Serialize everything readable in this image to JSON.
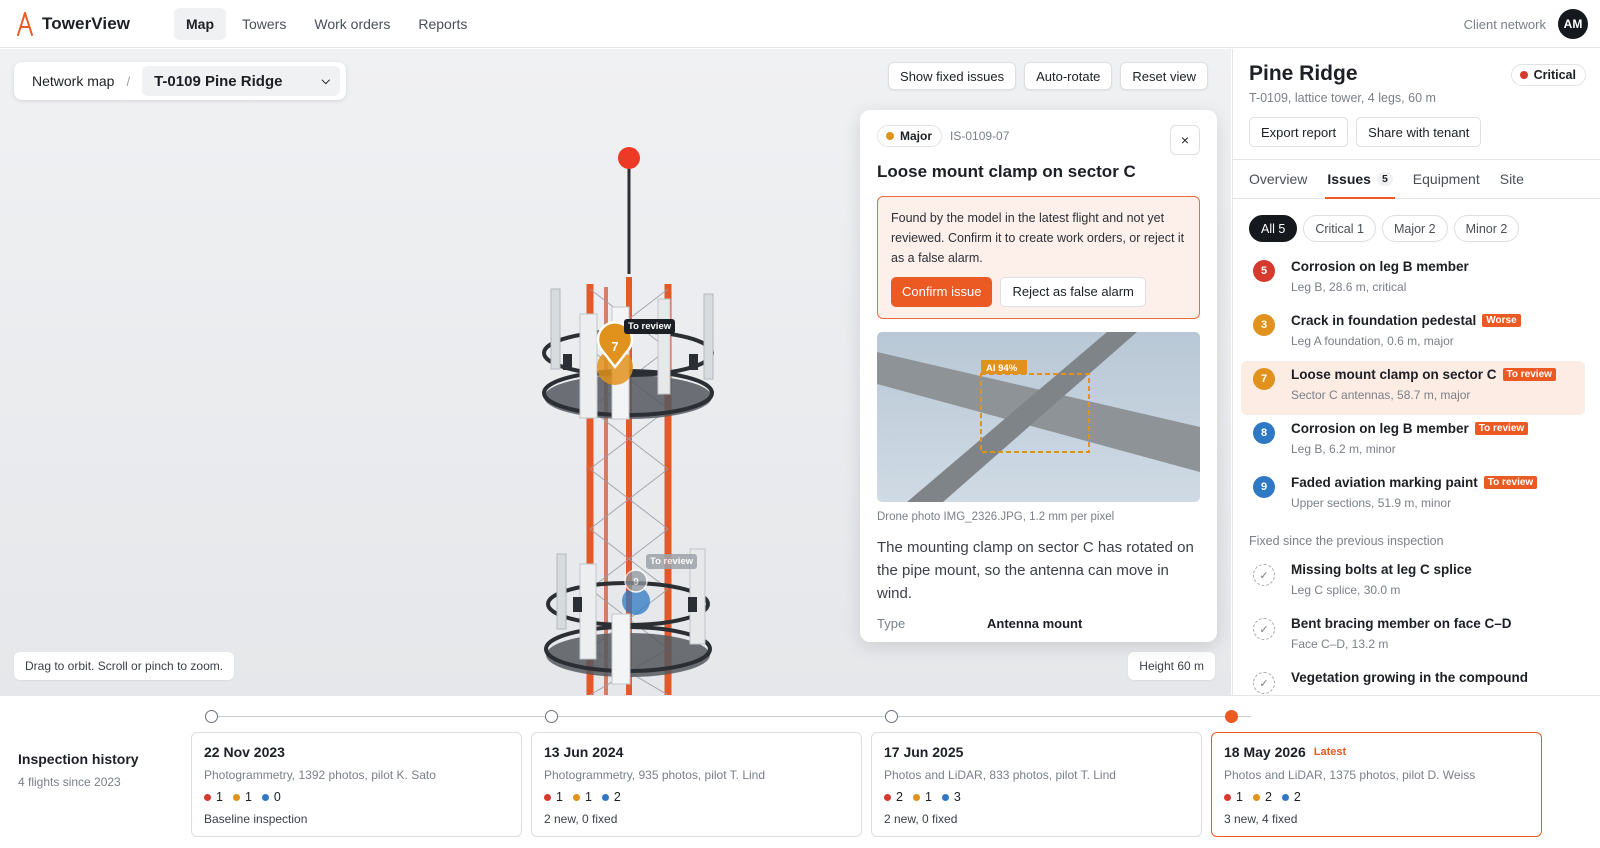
{
  "app": {
    "name": "TowerView"
  },
  "nav": [
    "Map",
    "Towers",
    "Work orders",
    "Reports"
  ],
  "header": {
    "client_link": "Client network",
    "avatar_initials": "AM"
  },
  "map": {
    "breadcrumb_root": "Network map",
    "breadcrumb_sep": "/",
    "tower_select": "T-0109 Pine Ridge",
    "view_buttons": [
      "Show fixed issues",
      "Auto-rotate",
      "Reset view"
    ],
    "hint": "Drag to orbit. Scroll or pinch to zoom.",
    "height_label": "Height 60 m",
    "pins": [
      {
        "number": "7",
        "label": "To review",
        "color": "#e0921c"
      },
      {
        "number": "9",
        "label": "To review",
        "color": "#2f78c4"
      }
    ]
  },
  "detail": {
    "severity": "Major",
    "severity_color": "#e0921c",
    "issue_id": "IS-0109-07",
    "close_glyph": "×",
    "title": "Loose mount clamp on sector C",
    "review_text": "Found by the model in the latest flight and not yet reviewed. Confirm it to create work orders, or reject it as a false alarm.",
    "confirm_label": "Confirm issue",
    "reject_label": "Reject as false alarm",
    "ai_label": "AI 94%",
    "photo_caption": "Drone photo IMG_2326.JPG, 1.2 mm per pixel",
    "description": "The mounting clamp on sector C has rotated on the pipe mount, so the antenna can move in wind.",
    "type_key": "Type",
    "type_value": "Antenna mount"
  },
  "panel": {
    "title": "Pine Ridge",
    "status": "Critical",
    "status_color": "#d63a2f",
    "subtitle": "T-0109, lattice tower, 4 legs, 60 m",
    "actions": [
      "Export report",
      "Share with tenant"
    ],
    "tabs": [
      {
        "label": "Overview",
        "count": ""
      },
      {
        "label": "Issues",
        "count": "5"
      },
      {
        "label": "Equipment",
        "count": ""
      },
      {
        "label": "Site",
        "count": ""
      }
    ],
    "filters": [
      "All 5",
      "Critical 1",
      "Major 2",
      "Minor 2"
    ],
    "issues": [
      {
        "num": "5",
        "color": "#d63a2f",
        "title": "Corrosion on leg B member",
        "tag": "",
        "sub": "Leg B, 28.6 m, critical"
      },
      {
        "num": "3",
        "color": "#e0921c",
        "title": "Crack in foundation pedestal",
        "tag": "Worse",
        "sub": "Leg A foundation, 0.6 m, major"
      },
      {
        "num": "7",
        "color": "#e0921c",
        "title": "Loose mount clamp on sector C",
        "tag": "To review",
        "sub": "Sector C antennas, 58.7 m, major"
      },
      {
        "num": "8",
        "color": "#2f78c4",
        "title": "Corrosion on leg B member",
        "tag": "To review",
        "sub": "Leg B, 6.2 m, minor"
      },
      {
        "num": "9",
        "color": "#2f78c4",
        "title": "Faded aviation marking paint",
        "tag": "To review",
        "sub": "Upper sections, 51.9 m, minor"
      }
    ],
    "fixed_heading": "Fixed since the previous inspection",
    "fixed": [
      {
        "title": "Missing bolts at leg C splice",
        "sub": "Leg C splice, 30.0 m"
      },
      {
        "title": "Bent bracing member on face C–D",
        "sub": "Face C–D, 13.2 m"
      },
      {
        "title": "Vegetation growing in the compound",
        "sub": ""
      }
    ]
  },
  "timeline": {
    "title": "Inspection history",
    "subtitle": "4 flights since 2023",
    "latest_label": "Latest",
    "flights": [
      {
        "date": "22 Nov 2023",
        "desc": "Photogrammetry, 1392 photos, pilot K. Sato",
        "critical": "1",
        "major": "1",
        "minor": "0",
        "note": "Baseline inspection"
      },
      {
        "date": "13 Jun 2024",
        "desc": "Photogrammetry, 935 photos, pilot T. Lind",
        "critical": "1",
        "major": "1",
        "minor": "2",
        "note": "2 new, 0 fixed"
      },
      {
        "date": "17 Jun 2025",
        "desc": "Photos and LiDAR, 833 photos, pilot T. Lind",
        "critical": "2",
        "major": "1",
        "minor": "3",
        "note": "2 new, 0 fixed"
      },
      {
        "date": "18 May 2026",
        "desc": "Photos and LiDAR, 1375 photos, pilot D. Weiss",
        "critical": "1",
        "major": "2",
        "minor": "2",
        "note": "3 new, 4 fixed"
      }
    ]
  },
  "colors": {
    "accent": "#ea5a22",
    "critical": "#d63a2f",
    "major": "#e0921c",
    "minor": "#2f78c4"
  }
}
